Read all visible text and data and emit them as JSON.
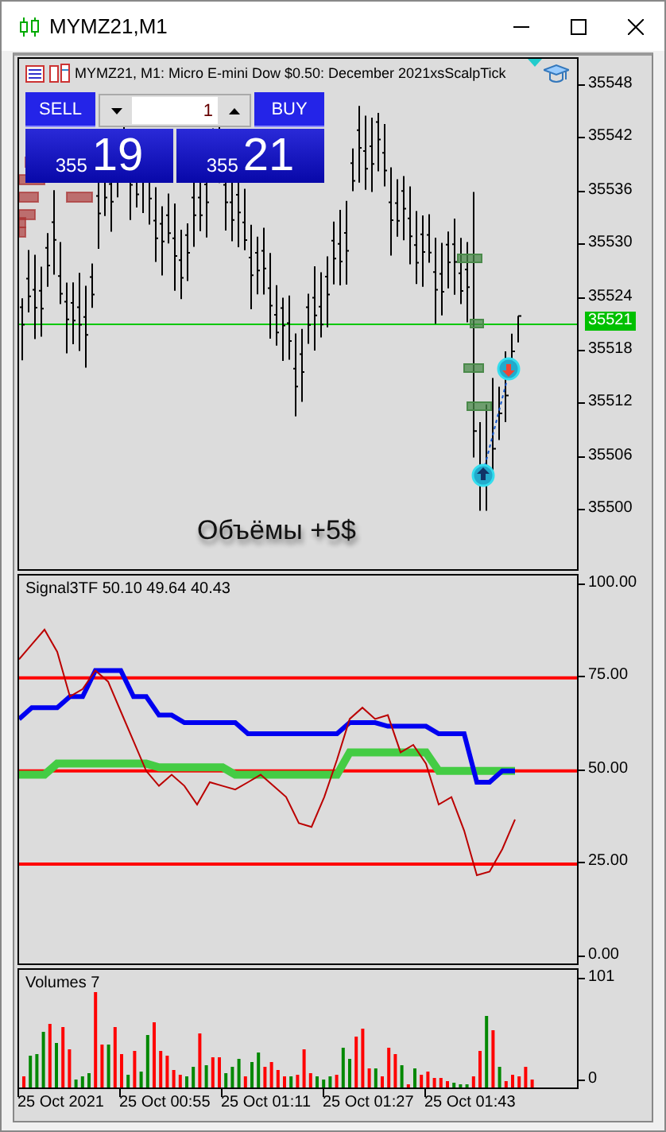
{
  "window": {
    "title": "MYMZ21,M1"
  },
  "chart": {
    "header": "MYMZ21, M1:  Micro E-mini Dow $0.50: December 2021xsScalpTick",
    "trade_panel": {
      "sell": "SELL",
      "buy": "BUY",
      "lot": "1",
      "bid_prefix": "355",
      "bid_big": "19",
      "ask_prefix": "355",
      "ask_big": "21"
    },
    "price_axis": [
      "35548",
      "35542",
      "35536",
      "35530",
      "35524",
      "35518",
      "35512",
      "35506",
      "35500"
    ],
    "current_price": "35521",
    "note": "Объёмы +5$"
  },
  "indicator": {
    "label": "Signal3TF 50.10 49.64 40.43",
    "chart_data": {
      "type": "line",
      "ylim": [
        -1.7,
        102.5
      ],
      "grid": true,
      "yticks": [
        {
          "value": 100,
          "label": "100.00"
        },
        {
          "value": 75,
          "label": "75.00"
        },
        {
          "value": 50,
          "label": "50.00"
        },
        {
          "value": 25,
          "label": "25.00"
        },
        {
          "value": 0,
          "label": "0.00"
        }
      ],
      "series": [
        {
          "color": "#44cc44",
          "values": [
            49,
            49,
            49,
            52,
            52,
            52,
            52,
            52,
            52,
            52,
            52,
            51,
            51,
            51,
            51,
            51,
            51,
            49,
            49,
            49,
            49,
            49,
            49,
            49,
            49,
            49,
            55,
            55,
            55,
            55,
            55,
            55,
            55,
            50,
            50,
            50,
            50,
            50,
            50,
            50
          ]
        },
        {
          "color": "#0000f0",
          "values": [
            64,
            67,
            67,
            67,
            70,
            70,
            77,
            77,
            77,
            70,
            70,
            65,
            65,
            63,
            63,
            63,
            63,
            63,
            60,
            60,
            60,
            60,
            60,
            60,
            60,
            60,
            63,
            63,
            63,
            62,
            62,
            62,
            62,
            60,
            60,
            60,
            47,
            47,
            50,
            50
          ]
        },
        {
          "color": "#bb0000",
          "values": [
            80,
            84,
            88,
            82,
            70,
            72,
            77,
            74,
            66,
            58,
            50,
            46,
            49,
            46,
            41,
            47,
            46,
            45,
            47,
            49,
            46,
            43,
            36,
            35,
            43,
            53,
            64,
            67,
            64,
            65,
            55,
            57,
            52,
            41,
            43,
            34,
            22,
            23,
            29,
            37
          ]
        }
      ]
    }
  },
  "volumes": {
    "label": "Volumes 7",
    "axis": [
      "101",
      "0"
    ]
  },
  "time_axis": [
    "25 Oct 2021",
    "25 Oct 00:55",
    "25 Oct 01:11",
    "25 Oct 01:27",
    "25 Oct 01:43"
  ]
}
